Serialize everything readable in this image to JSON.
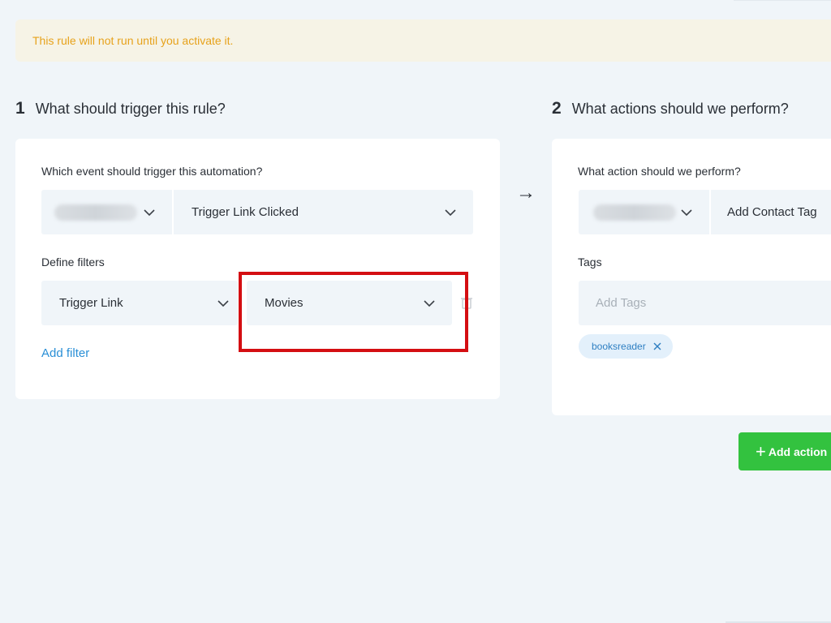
{
  "banner": {
    "message": "This rule will not run until you activate it."
  },
  "trigger_step": {
    "number": "1",
    "title": "What should trigger this rule?",
    "event_label": "Which event should trigger this automation?",
    "event_select": {
      "app_icon": "chevron-down-icon",
      "value": "Trigger Link Clicked"
    },
    "filters_label": "Define filters",
    "filter": {
      "field": "Trigger Link",
      "value": "Movies"
    },
    "add_filter_label": "Add filter"
  },
  "arrow": "→",
  "action_step": {
    "number": "2",
    "title": "What actions should we perform?",
    "action_label": "What action should we perform?",
    "action_select": {
      "value": "Add Contact Tag"
    },
    "tags_label": "Tags",
    "tags_input": {
      "placeholder": "Add Tags",
      "value": ""
    },
    "tags": [
      "booksreader"
    ],
    "add_action_label": "Add action"
  },
  "colors": {
    "background": "#f0f5f9",
    "banner_text": "#e7a21b",
    "link": "#2a8fd6",
    "primary_button": "#33c23f",
    "highlight": "#d40e12"
  }
}
